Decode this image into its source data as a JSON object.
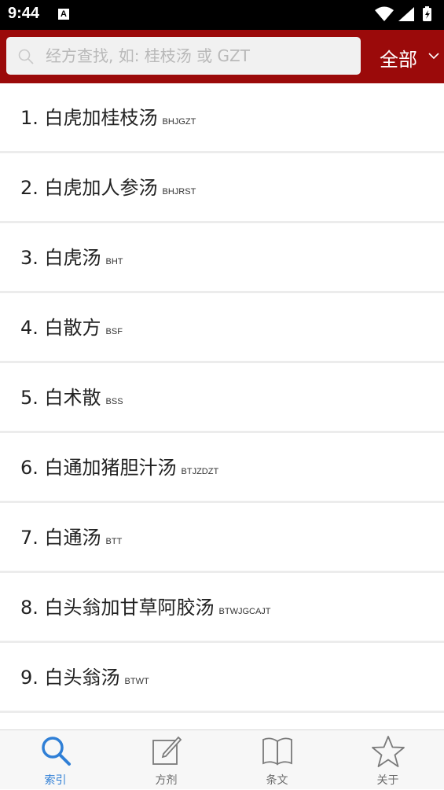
{
  "status_bar": {
    "time": "9:44",
    "notification_glyph": "A"
  },
  "header": {
    "search": {
      "placeholder": "经方查找, 如: 桂枝汤 或 GZT",
      "value": ""
    },
    "filter": {
      "label": "全部"
    },
    "accent_color": "#9b0a0a"
  },
  "list": {
    "items": [
      {
        "title": "1. 白虎加桂枝汤",
        "abbr": "BHJGZT"
      },
      {
        "title": "2. 白虎加人参汤",
        "abbr": "BHJRST"
      },
      {
        "title": "3. 白虎汤",
        "abbr": "BHT"
      },
      {
        "title": "4. 白散方",
        "abbr": "BSF"
      },
      {
        "title": "5. 白术散",
        "abbr": "BSS"
      },
      {
        "title": "6. 白通加猪胆汁汤",
        "abbr": "BTJZDZT"
      },
      {
        "title": "7. 白通汤",
        "abbr": "BTT"
      },
      {
        "title": "8. 白头翁加甘草阿胶汤",
        "abbr": "BTWJGCAJT"
      },
      {
        "title": "9. 白头翁汤",
        "abbr": "BTWT"
      },
      {
        "title": "",
        "abbr": ""
      }
    ]
  },
  "tabbar": {
    "tabs": [
      {
        "label": "索引",
        "icon": "search-icon",
        "active": true
      },
      {
        "label": "方剂",
        "icon": "edit-icon",
        "active": false
      },
      {
        "label": "条文",
        "icon": "book-icon",
        "active": false
      },
      {
        "label": "关于",
        "icon": "star-icon",
        "active": false
      }
    ],
    "active_color": "#2f7fd6"
  }
}
